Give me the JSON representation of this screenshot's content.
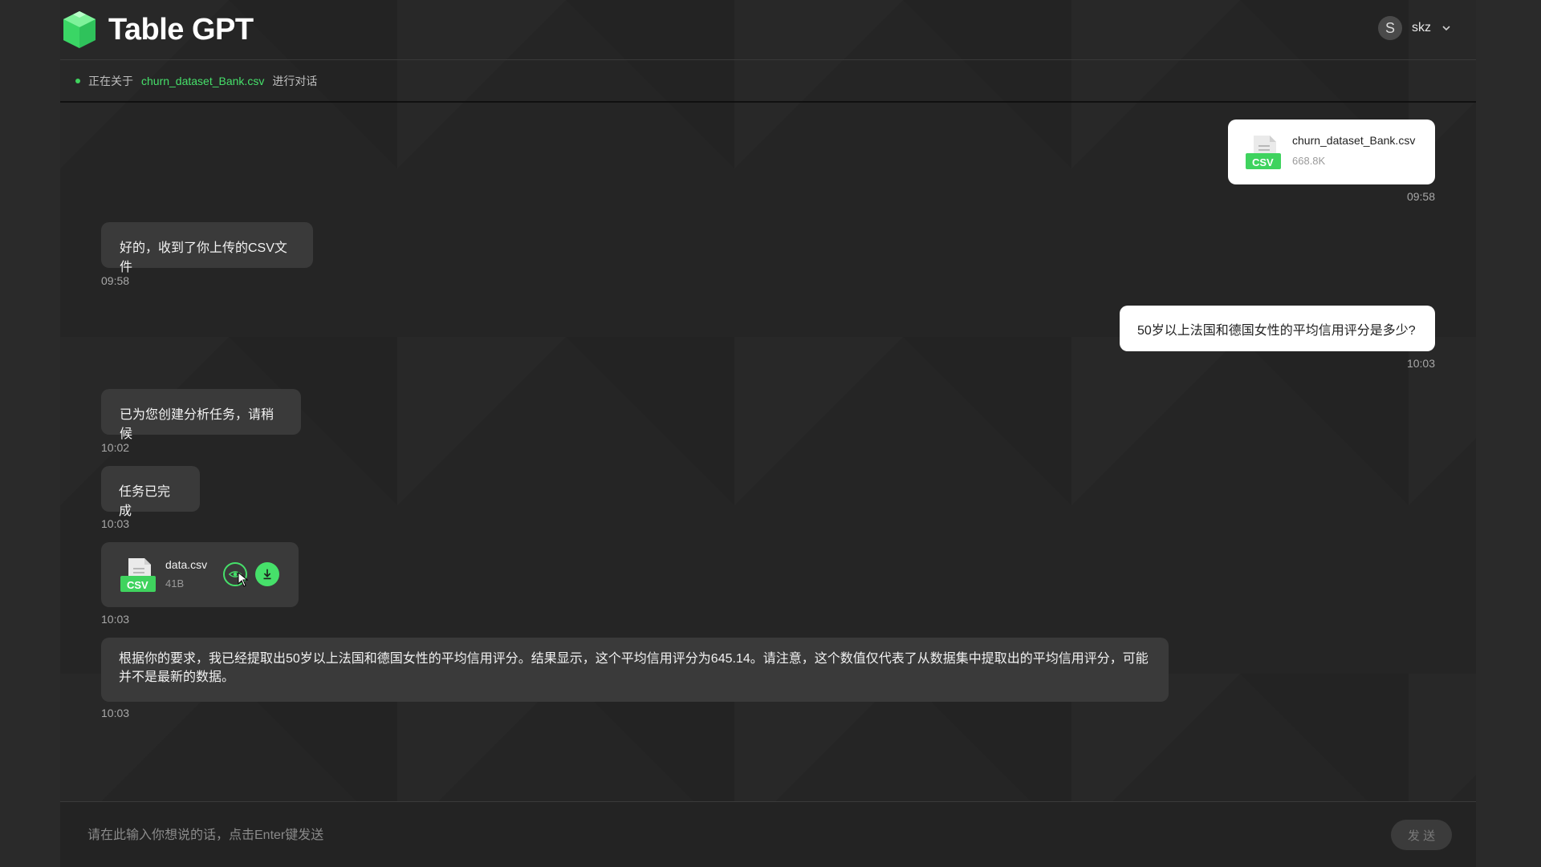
{
  "app": {
    "title": "Table GPT"
  },
  "user": {
    "avatar_initial": "S",
    "name": "skz"
  },
  "context": {
    "prefix": "正在关于",
    "file": "churn_dataset_Bank.csv",
    "suffix": "进行对话"
  },
  "messages": {
    "upload": {
      "file_name": "churn_dataset_Bank.csv",
      "file_size": "668.8K",
      "badge": "CSV",
      "time": "09:58"
    },
    "ack": {
      "text": "好的，收到了你上传的CSV文件",
      "time": "09:58"
    },
    "question": {
      "text": "50岁以上法国和德国女性的平均信用评分是多少?",
      "time": "10:03"
    },
    "task_created": {
      "text": "已为您创建分析任务，请稍候",
      "time": "10:02"
    },
    "task_done": {
      "text": "任务已完成",
      "time": "10:03"
    },
    "result_file": {
      "file_name": "data.csv",
      "file_size": "41B",
      "badge": "CSV",
      "time": "10:03"
    },
    "answer": {
      "text": "根据你的要求，我已经提取出50岁以上法国和德国女性的平均信用评分。结果显示，这个平均信用评分为645.14。请注意，这个数值仅代表了从数据集中提取出的平均信用评分，可能并不是最新的数据。",
      "time": "10:03"
    }
  },
  "input": {
    "placeholder": "请在此输入你想说的话，点击Enter键发送"
  },
  "send_label": "发 送",
  "colors": {
    "accent": "#46e06a",
    "bubble_bot": "#3a3a3a",
    "bubble_user": "#ffffff",
    "background": "#252525"
  },
  "icons": {
    "logo": "cube-logo-icon",
    "preview": "eye-icon",
    "download": "download-icon",
    "dropdown": "chevron-down-icon",
    "file": "csv-file-icon"
  }
}
